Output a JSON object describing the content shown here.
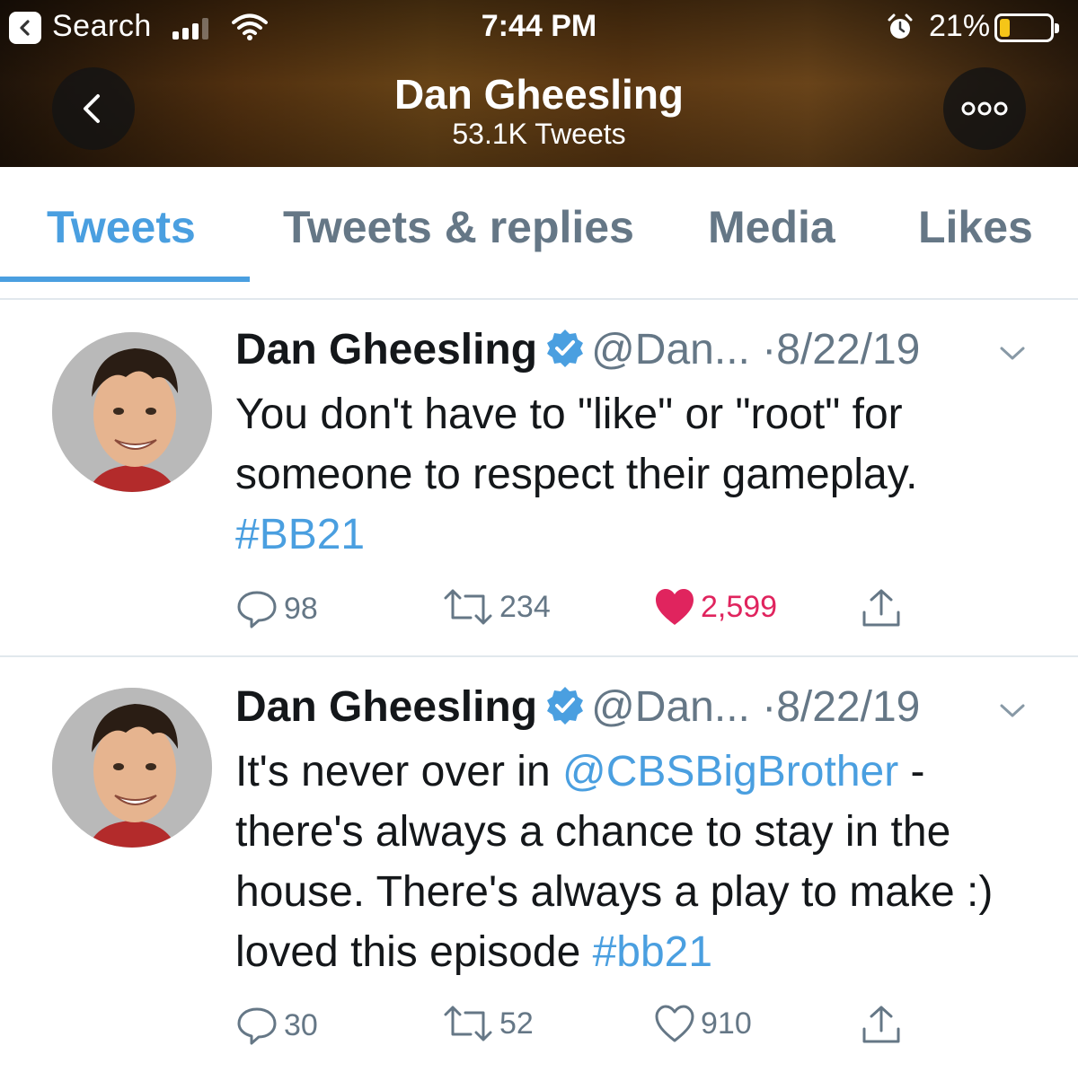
{
  "status_bar": {
    "back_app": "Search",
    "time": "7:44 PM",
    "battery_percent": "21%",
    "battery_level": 0.21,
    "icons": [
      "back-to-app-icon",
      "cellular-signal-icon",
      "wifi-icon",
      "alarm-icon",
      "battery-icon"
    ]
  },
  "header": {
    "title": "Dan Gheesling",
    "subtitle": "53.1K Tweets",
    "back_icon": "chevron-left-icon",
    "more_icon": "more-options-icon"
  },
  "tabs": {
    "items": [
      {
        "label": "Tweets",
        "active": true
      },
      {
        "label": "Tweets & replies",
        "active": false
      },
      {
        "label": "Media",
        "active": false
      },
      {
        "label": "Likes",
        "active": false
      }
    ]
  },
  "colors": {
    "accent": "#4a9fe0",
    "like_active": "#e0245e",
    "muted_text": "#657786",
    "primary_text": "#14171a",
    "battery_fill": "#f5c518"
  },
  "tweets": [
    {
      "name": "Dan Gheesling",
      "handle": "@Dan...",
      "date": "·8/22/19",
      "body_parts": [
        {
          "text": "You don't have to \"like\" or \"root\" for someone to respect their gameplay. ",
          "link": false
        },
        {
          "text": "#BB21",
          "link": true
        }
      ],
      "replies": "98",
      "retweets": "234",
      "likes": "2,599",
      "liked": true
    },
    {
      "name": "Dan Gheesling",
      "handle": "@Dan...",
      "date": "·8/22/19",
      "body_parts": [
        {
          "text": "It's never over in ",
          "link": false
        },
        {
          "text": "@CBSBigBrother",
          "link": true
        },
        {
          "text": " - there's always a chance to stay in the house. There's always a play to make :) loved this episode ",
          "link": false
        },
        {
          "text": "#bb21",
          "link": true
        }
      ],
      "replies": "30",
      "retweets": "52",
      "likes": "910",
      "liked": false
    }
  ]
}
